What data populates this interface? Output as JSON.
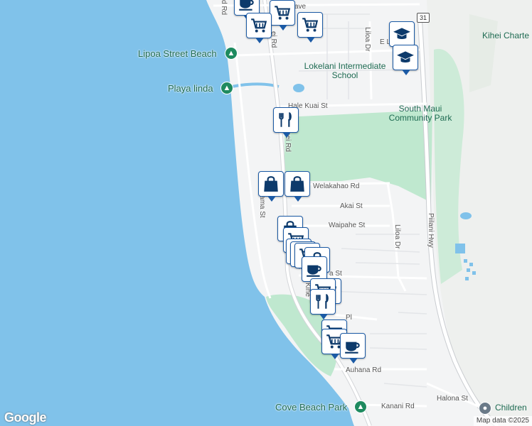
{
  "map": {
    "places": {
      "lipoa_beach": "Lipoa Street Beach",
      "playa_linda": "Playa linda",
      "school": "Lokelani Intermediate School",
      "park": "South Maui Community Park",
      "kihei_charter": "Kihei Charte",
      "cove_beach": "Cove Beach Park",
      "children": "Children"
    },
    "streets": {
      "kihei_rd_top": "ei Rd",
      "kihei_rd_mid": "hei Rd",
      "hale_kuai": "Hale Kuai St",
      "welakahao": "Welakahao Rd",
      "akai": "Akai St",
      "waipahe": "Waipahe St",
      "liloa_top": "Liloa Dr",
      "liloa_mid": "Liloa Dr",
      "pilani": "Piilani Hwy",
      "halama": "Halama St",
      "auhana": "Auhana Rd",
      "kanani": "Kanani Rd",
      "halona": "Halona St",
      "kihe_lower": "Kihe",
      "st_frag": "a St",
      "pl_frag": "Pl",
      "ave_frag": "ave",
      "e_frag": "E L",
      "rd_frag": "d Rd",
      "highway_num": "31"
    },
    "markers": [
      {
        "type": "coffee-icon"
      },
      {
        "type": "shopping-cart-icon"
      },
      {
        "type": "shopping-cart-icon"
      },
      {
        "type": "shopping-cart-icon"
      },
      {
        "type": "school-icon"
      },
      {
        "type": "school-icon"
      },
      {
        "type": "restaurant-icon"
      },
      {
        "type": "shopping-bag-icon"
      },
      {
        "type": "shopping-bag-icon"
      },
      {
        "type": "shopping-bag-icon"
      },
      {
        "type": "shopping-cart-icon"
      },
      {
        "type": "shopping-cart-icon"
      },
      {
        "type": "shopping-cart-icon"
      },
      {
        "type": "shopping-cart-icon"
      },
      {
        "type": "shopping-bag-icon"
      },
      {
        "type": "coffee-icon"
      },
      {
        "type": "shopping-cart-icon"
      },
      {
        "type": "restaurant-icon"
      },
      {
        "type": "shopping-cart-icon"
      },
      {
        "type": "shopping-cart-icon"
      },
      {
        "type": "coffee-icon"
      }
    ],
    "colors": {
      "water": "#80c2ea",
      "park": "#bfe8cf",
      "road": "#ffffff",
      "marker_border": "#1b5aa5",
      "icon": "#0d3a6b"
    }
  },
  "branding": {
    "logo": "Google",
    "attribution": "Map data ©2025"
  }
}
